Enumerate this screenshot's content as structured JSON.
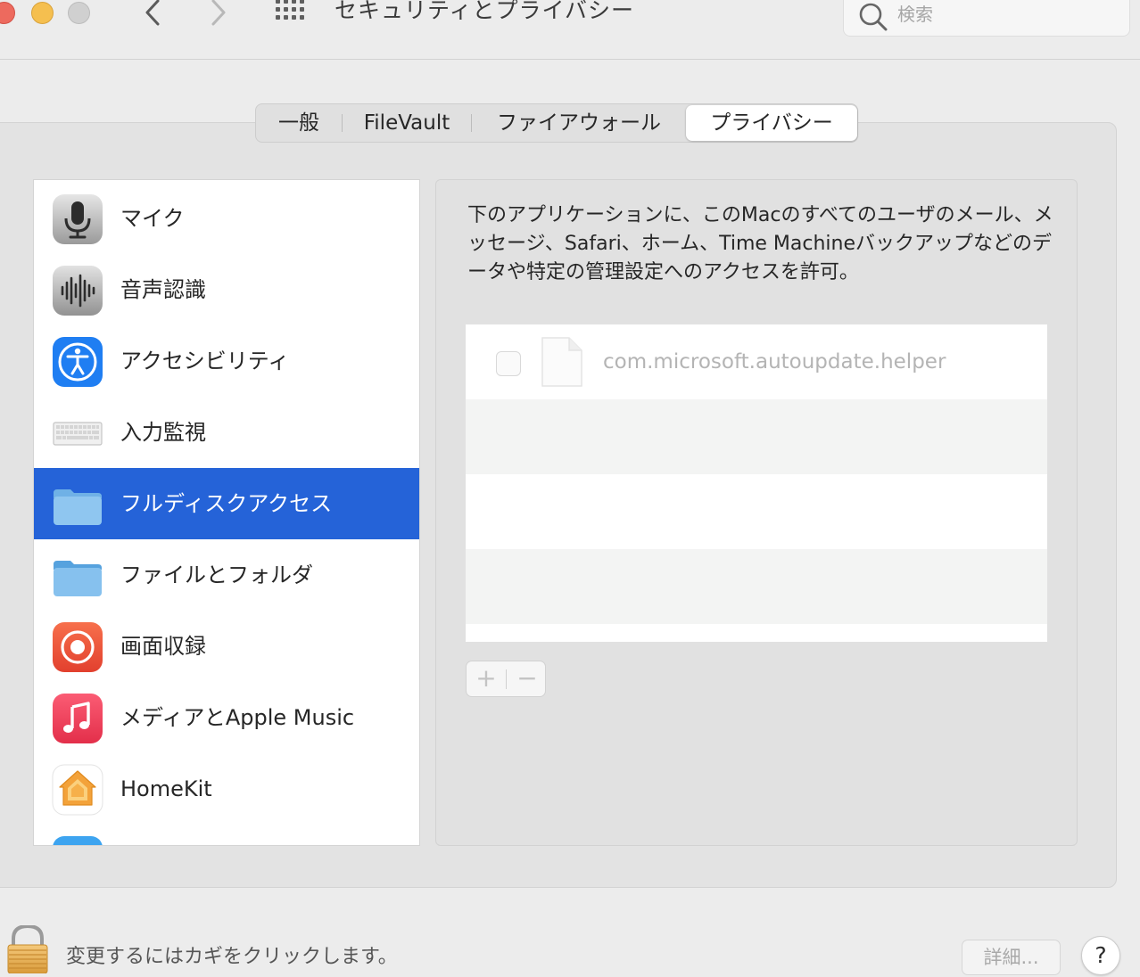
{
  "window": {
    "title": "セキュリティとプライバシー",
    "search_placeholder": "検索"
  },
  "tabs": [
    {
      "label": "一般"
    },
    {
      "label": "FileVault"
    },
    {
      "label": "ファイアウォール"
    },
    {
      "label": "プライバシー",
      "selected": true
    }
  ],
  "sidebar": {
    "items": [
      {
        "label": "マイク",
        "icon": "microphone-icon"
      },
      {
        "label": "音声認識",
        "icon": "speech-recognition-icon"
      },
      {
        "label": "アクセシビリティ",
        "icon": "accessibility-icon"
      },
      {
        "label": "入力監視",
        "icon": "keyboard-icon"
      },
      {
        "label": "フルディスクアクセス",
        "icon": "folder-icon",
        "selected": true
      },
      {
        "label": "ファイルとフォルダ",
        "icon": "folder-icon"
      },
      {
        "label": "画面収録",
        "icon": "screen-recording-icon"
      },
      {
        "label": "メディアとApple Music",
        "icon": "music-icon"
      },
      {
        "label": "HomeKit",
        "icon": "homekit-icon"
      }
    ]
  },
  "content": {
    "description": "下のアプリケーションに、このMacのすべてのユーザのメール、メッセージ、Safari、ホーム、Time Machineバックアップなどのデータや特定の管理設定へのアクセスを許可。",
    "apps": [
      {
        "name": "com.microsoft.autoupdate.helper",
        "checked": false
      }
    ],
    "add_label": "+",
    "remove_label": "−"
  },
  "footer": {
    "lock_text": "変更するにはカギをクリックします。",
    "advanced_label": "詳細...",
    "help_label": "?"
  },
  "colors": {
    "selection": "#2563d8",
    "close": "#ed6a5e",
    "minimize": "#f5bf4f"
  }
}
